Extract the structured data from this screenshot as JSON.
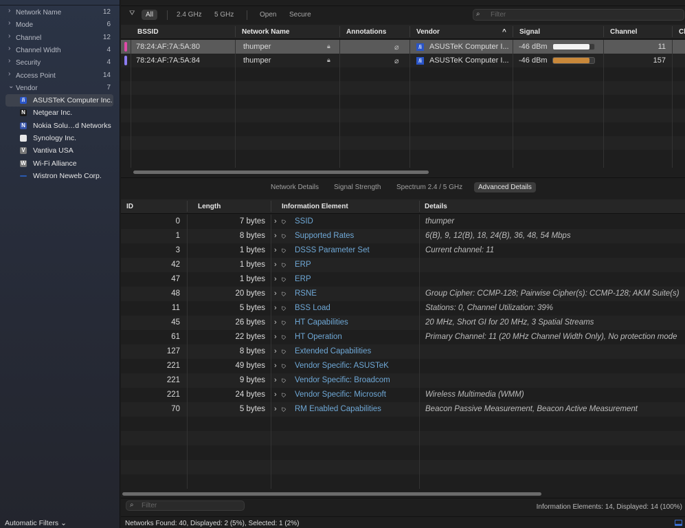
{
  "sidebar": {
    "groups": [
      {
        "label": "Network Name",
        "count": "12",
        "expanded": false
      },
      {
        "label": "Mode",
        "count": "6",
        "expanded": false
      },
      {
        "label": "Channel",
        "count": "12",
        "expanded": false
      },
      {
        "label": "Channel Width",
        "count": "4",
        "expanded": false
      },
      {
        "label": "Security",
        "count": "4",
        "expanded": false
      },
      {
        "label": "Access Point",
        "count": "14",
        "expanded": false
      },
      {
        "label": "Vendor",
        "count": "7",
        "expanded": true
      }
    ],
    "vendors": [
      {
        "label": "ASUSTeK Computer Inc.",
        "icon": "asus-logo-icon",
        "glyph": "/i",
        "color": "#2a55c8",
        "selected": true
      },
      {
        "label": "Netgear Inc.",
        "icon": "netgear-logo-icon",
        "glyph": "N",
        "color": "#1a1a1a"
      },
      {
        "label": "Nokia Solu…d Networks",
        "icon": "nokia-logo-icon",
        "glyph": "N",
        "color": "#3552a8"
      },
      {
        "label": "Synology Inc.",
        "icon": "synology-logo-icon",
        "glyph": "",
        "color": "#e8e8e8"
      },
      {
        "label": "Vantiva USA",
        "icon": "vantiva-logo-icon",
        "glyph": "V",
        "color": "#777"
      },
      {
        "label": "Wi-Fi Alliance",
        "icon": "wifi-alliance-logo-icon",
        "glyph": "W",
        "color": "#777"
      },
      {
        "label": "Wistron Neweb Corp.",
        "icon": "wistron-logo-icon",
        "glyph": "",
        "color": "#2a5ab0"
      }
    ],
    "auto_filters": "Automatic Filters ⌄"
  },
  "toolbar": {
    "all": "All",
    "ghz24": "2.4 GHz",
    "ghz5": "5 GHz",
    "open": "Open",
    "secure": "Secure",
    "filter_placeholder": "Filter"
  },
  "networks": {
    "columns": [
      "BSSID",
      "Network Name",
      "Annotations",
      "Vendor",
      "Signal",
      "Channel",
      "Ch"
    ],
    "rows": [
      {
        "color": "#e04aa8",
        "bssid": "78:24:AF:7A:5A:80",
        "name": "thumper",
        "vendor": "ASUSTeK Computer I...",
        "signal": "-46 dBm",
        "signal_pct": 88,
        "bar_color": "#f2f2f2",
        "channel": "11",
        "selected": true
      },
      {
        "color": "#8c7cf0",
        "bssid": "78:24:AF:7A:5A:84",
        "name": "thumper",
        "vendor": "ASUSTeK Computer I...",
        "signal": "-46 dBm",
        "signal_pct": 88,
        "bar_color": "#c9883a",
        "channel": "157",
        "selected": false
      }
    ]
  },
  "tabs": [
    "Network Details",
    "Signal Strength",
    "Spectrum 2.4 / 5 GHz",
    "Advanced Details"
  ],
  "active_tab": "Advanced Details",
  "ie": {
    "columns": [
      "ID",
      "Length",
      "Information Element",
      "Details"
    ],
    "rows": [
      {
        "id": "0",
        "len": "7 bytes",
        "name": "SSID",
        "details": "thumper"
      },
      {
        "id": "1",
        "len": "8 bytes",
        "name": "Supported Rates",
        "details": "6(B), 9, 12(B), 18, 24(B), 36, 48, 54 Mbps"
      },
      {
        "id": "3",
        "len": "1 bytes",
        "name": "DSSS Parameter Set",
        "details": "Current channel: 11"
      },
      {
        "id": "42",
        "len": "1 bytes",
        "name": "ERP",
        "details": ""
      },
      {
        "id": "47",
        "len": "1 bytes",
        "name": "ERP",
        "details": ""
      },
      {
        "id": "48",
        "len": "20 bytes",
        "name": "RSNE",
        "details": "Group Cipher: CCMP-128; Pairwise Cipher(s): CCMP-128; AKM Suite(s)"
      },
      {
        "id": "11",
        "len": "5 bytes",
        "name": "BSS Load",
        "details": "Stations: 0, Channel Utilization: 39%"
      },
      {
        "id": "45",
        "len": "26 bytes",
        "name": "HT Capabilities",
        "details": "20 MHz, Short GI for 20 MHz, 3 Spatial Streams"
      },
      {
        "id": "61",
        "len": "22 bytes",
        "name": "HT Operation",
        "details": "Primary Channel: 11 (20 MHz Channel Width Only), No protection mode"
      },
      {
        "id": "127",
        "len": "8 bytes",
        "name": "Extended Capabilities",
        "details": ""
      },
      {
        "id": "221",
        "len": "49 bytes",
        "name": "Vendor Specific: ASUSTeK",
        "details": ""
      },
      {
        "id": "221",
        "len": "9 bytes",
        "name": "Vendor Specific: Broadcom",
        "details": ""
      },
      {
        "id": "221",
        "len": "24 bytes",
        "name": "Vendor Specific: Microsoft",
        "details": "Wireless Multimedia (WMM)"
      },
      {
        "id": "70",
        "len": "5 bytes",
        "name": "RM Enabled Capabilities",
        "details": "Beacon Passive Measurement, Beacon Active Measurement"
      }
    ],
    "filter_placeholder": "Filter",
    "summary": "Information Elements: 14, Displayed: 14 (100%)"
  },
  "status": {
    "text": "Networks Found: 40, Displayed: 2 (5%), Selected: 1 (2%)"
  }
}
